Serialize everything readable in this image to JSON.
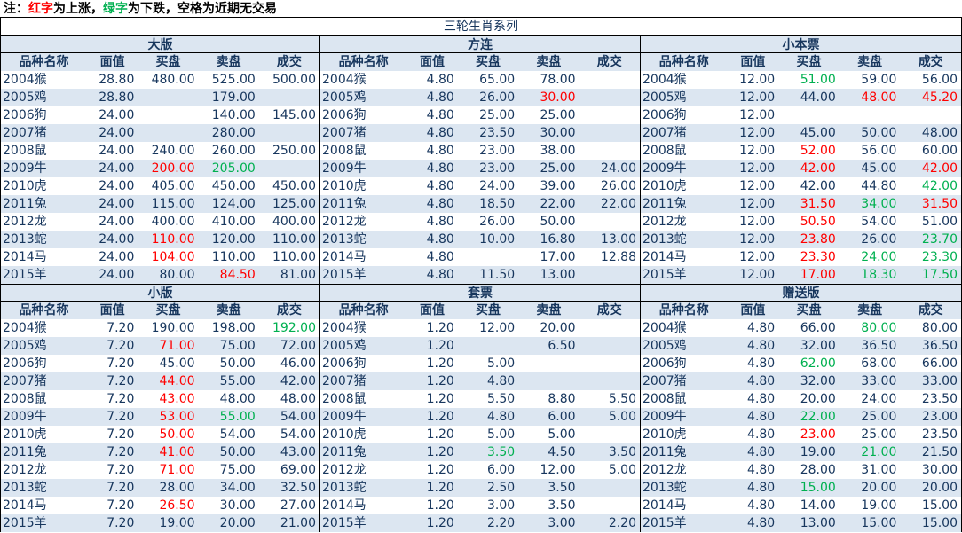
{
  "note": {
    "prefix": "注：",
    "red_word": "红字",
    "red_text": "为上涨，",
    "green_word": "绿字",
    "green_text": "为下跌，空格为近期无交易"
  },
  "title": "三轮生肖系列",
  "colors": {
    "up": "#ff0000",
    "down": "#00b050",
    "header_bg": "#dce6f1",
    "text": "#17365d"
  },
  "columns": [
    "品种名称",
    "面值",
    "买盘",
    "卖盘",
    "成交"
  ],
  "panels": [
    {
      "title": "大版",
      "rows": [
        {
          "name": "2004猴",
          "face": "28.80",
          "bid": "480.00",
          "ask": "525.00",
          "deal": "500.00"
        },
        {
          "name": "2005鸡",
          "face": "28.80",
          "bid": "",
          "ask": "179.00",
          "deal": ""
        },
        {
          "name": "2006狗",
          "face": "24.00",
          "bid": "",
          "ask": "140.00",
          "deal": "145.00"
        },
        {
          "name": "2007猪",
          "face": "24.00",
          "bid": "",
          "ask": "280.00",
          "deal": ""
        },
        {
          "name": "2008鼠",
          "face": "24.00",
          "bid": "240.00",
          "ask": "260.00",
          "deal": "250.00"
        },
        {
          "name": "2009牛",
          "face": "24.00",
          "bid": "200.00",
          "bid_c": "up",
          "ask": "205.00",
          "ask_c": "down",
          "deal": ""
        },
        {
          "name": "2010虎",
          "face": "24.00",
          "bid": "405.00",
          "ask": "450.00",
          "deal": "450.00"
        },
        {
          "name": "2011兔",
          "face": "24.00",
          "bid": "115.00",
          "ask": "124.00",
          "deal": "125.00"
        },
        {
          "name": "2012龙",
          "face": "24.00",
          "bid": "400.00",
          "ask": "410.00",
          "deal": "400.00"
        },
        {
          "name": "2013蛇",
          "face": "24.00",
          "bid": "110.00",
          "bid_c": "up",
          "ask": "120.00",
          "deal": "110.00"
        },
        {
          "name": "2014马",
          "face": "24.00",
          "bid": "104.00",
          "bid_c": "up",
          "ask": "110.00",
          "deal": "110.00"
        },
        {
          "name": "2015羊",
          "face": "24.00",
          "bid": "80.00",
          "ask": "84.50",
          "ask_c": "up",
          "deal": "81.00"
        }
      ]
    },
    {
      "title": "方连",
      "rows": [
        {
          "name": "2004猴",
          "face": "4.80",
          "bid": "65.00",
          "ask": "78.00",
          "deal": ""
        },
        {
          "name": "2005鸡",
          "face": "4.80",
          "bid": "26.00",
          "ask": "30.00",
          "ask_c": "up",
          "deal": ""
        },
        {
          "name": "2006狗",
          "face": "4.80",
          "bid": "25.00",
          "ask": "25.00",
          "deal": ""
        },
        {
          "name": "2007猪",
          "face": "4.80",
          "bid": "23.50",
          "ask": "30.00",
          "deal": ""
        },
        {
          "name": "2008鼠",
          "face": "4.80",
          "bid": "23.00",
          "ask": "38.00",
          "deal": ""
        },
        {
          "name": "2009牛",
          "face": "4.80",
          "bid": "23.00",
          "ask": "25.00",
          "deal": "24.00"
        },
        {
          "name": "2010虎",
          "face": "4.80",
          "bid": "24.00",
          "ask": "39.00",
          "deal": "26.00"
        },
        {
          "name": "2011兔",
          "face": "4.80",
          "bid": "18.50",
          "ask": "22.00",
          "deal": "22.00"
        },
        {
          "name": "2012龙",
          "face": "4.80",
          "bid": "26.00",
          "ask": "50.00",
          "deal": ""
        },
        {
          "name": "2013蛇",
          "face": "4.80",
          "bid": "10.00",
          "ask": "16.80",
          "deal": "13.00"
        },
        {
          "name": "2014马",
          "face": "4.80",
          "bid": "",
          "ask": "17.00",
          "deal": "12.88"
        },
        {
          "name": "2015羊",
          "face": "4.80",
          "bid": "11.50",
          "ask": "13.00",
          "deal": ""
        }
      ]
    },
    {
      "title": "小本票",
      "rows": [
        {
          "name": "2004猴",
          "face": "12.00",
          "bid": "51.00",
          "bid_c": "down",
          "ask": "59.00",
          "deal": "56.00"
        },
        {
          "name": "2005鸡",
          "face": "12.00",
          "bid": "44.00",
          "ask": "48.00",
          "ask_c": "up",
          "deal": "45.20",
          "deal_c": "up"
        },
        {
          "name": "2006狗",
          "face": "12.00",
          "bid": "",
          "ask": "",
          "deal": ""
        },
        {
          "name": "2007猪",
          "face": "12.00",
          "bid": "45.00",
          "ask": "50.00",
          "deal": "48.00"
        },
        {
          "name": "2008鼠",
          "face": "12.00",
          "bid": "52.00",
          "bid_c": "up",
          "ask": "56.00",
          "deal": "60.00"
        },
        {
          "name": "2009牛",
          "face": "12.00",
          "bid": "42.00",
          "bid_c": "up",
          "ask": "45.00",
          "deal": "42.00",
          "deal_c": "up"
        },
        {
          "name": "2010虎",
          "face": "12.00",
          "bid": "42.00",
          "ask": "44.80",
          "deal": "42.00",
          "deal_c": "down"
        },
        {
          "name": "2011兔",
          "face": "12.00",
          "bid": "31.50",
          "bid_c": "up",
          "ask": "34.00",
          "ask_c": "down",
          "deal": "31.50",
          "deal_c": "up"
        },
        {
          "name": "2012龙",
          "face": "12.00",
          "bid": "50.50",
          "bid_c": "up",
          "ask": "54.00",
          "deal": "51.00"
        },
        {
          "name": "2013蛇",
          "face": "12.00",
          "bid": "23.80",
          "bid_c": "up",
          "ask": "26.00",
          "deal": "23.70",
          "deal_c": "down"
        },
        {
          "name": "2014马",
          "face": "12.00",
          "bid": "23.30",
          "bid_c": "up",
          "ask": "24.00",
          "ask_c": "down",
          "deal": "23.30",
          "deal_c": "down"
        },
        {
          "name": "2015羊",
          "face": "12.00",
          "bid": "17.00",
          "bid_c": "up",
          "ask": "18.30",
          "ask_c": "down",
          "deal": "17.50",
          "deal_c": "down"
        }
      ]
    },
    {
      "title": "小版",
      "rows": [
        {
          "name": "2004猴",
          "face": "7.20",
          "bid": "190.00",
          "ask": "198.00",
          "deal": "192.00",
          "deal_c": "down"
        },
        {
          "name": "2005鸡",
          "face": "7.20",
          "bid": "71.00",
          "bid_c": "up",
          "ask": "75.00",
          "deal": "72.00"
        },
        {
          "name": "2006狗",
          "face": "7.20",
          "bid": "45.00",
          "ask": "50.00",
          "deal": "46.00"
        },
        {
          "name": "2007猪",
          "face": "7.20",
          "bid": "44.00",
          "bid_c": "up",
          "ask": "55.00",
          "deal": "42.00"
        },
        {
          "name": "2008鼠",
          "face": "7.20",
          "bid": "43.00",
          "bid_c": "up",
          "ask": "48.00",
          "deal": "48.00"
        },
        {
          "name": "2009牛",
          "face": "7.20",
          "bid": "53.00",
          "bid_c": "up",
          "ask": "55.00",
          "ask_c": "down",
          "deal": "54.00"
        },
        {
          "name": "2010虎",
          "face": "7.20",
          "bid": "50.00",
          "bid_c": "up",
          "ask": "54.00",
          "deal": "54.00"
        },
        {
          "name": "2011兔",
          "face": "7.20",
          "bid": "41.00",
          "bid_c": "up",
          "ask": "50.00",
          "deal": "43.00"
        },
        {
          "name": "2012龙",
          "face": "7.20",
          "bid": "71.00",
          "bid_c": "up",
          "ask": "75.00",
          "deal": "69.00"
        },
        {
          "name": "2013蛇",
          "face": "7.20",
          "bid": "28.00",
          "ask": "34.00",
          "deal": "32.50"
        },
        {
          "name": "2014马",
          "face": "7.20",
          "bid": "26.50",
          "bid_c": "up",
          "ask": "30.00",
          "deal": "27.00"
        },
        {
          "name": "2015羊",
          "face": "7.20",
          "bid": "19.00",
          "ask": "20.00",
          "deal": "21.00"
        }
      ]
    },
    {
      "title": "套票",
      "rows": [
        {
          "name": "2004猴",
          "face": "1.20",
          "bid": "12.00",
          "ask": "20.00",
          "deal": ""
        },
        {
          "name": "2005鸡",
          "face": "1.20",
          "bid": "",
          "ask": "6.50",
          "deal": ""
        },
        {
          "name": "2006狗",
          "face": "1.20",
          "bid": "5.00",
          "ask": "",
          "deal": ""
        },
        {
          "name": "2007猪",
          "face": "1.20",
          "bid": "4.80",
          "ask": "",
          "deal": ""
        },
        {
          "name": "2008鼠",
          "face": "1.20",
          "bid": "5.50",
          "ask": "8.80",
          "deal": "5.50"
        },
        {
          "name": "2009牛",
          "face": "1.20",
          "bid": "4.80",
          "ask": "6.00",
          "deal": "5.00"
        },
        {
          "name": "2010虎",
          "face": "1.20",
          "bid": "5.00",
          "ask": "5.00",
          "deal": ""
        },
        {
          "name": "2011兔",
          "face": "1.20",
          "bid": "3.50",
          "bid_c": "down",
          "ask": "4.50",
          "deal": "3.50"
        },
        {
          "name": "2012龙",
          "face": "1.20",
          "bid": "6.00",
          "ask": "12.00",
          "deal": "5.00"
        },
        {
          "name": "2013蛇",
          "face": "1.20",
          "bid": "2.50",
          "ask": "3.50",
          "deal": ""
        },
        {
          "name": "2014马",
          "face": "1.20",
          "bid": "3.00",
          "ask": "3.50",
          "deal": ""
        },
        {
          "name": "2015羊",
          "face": "1.20",
          "bid": "2.20",
          "ask": "3.00",
          "deal": "2.20"
        }
      ]
    },
    {
      "title": "赠送版",
      "rows": [
        {
          "name": "2004猴",
          "face": "4.80",
          "bid": "66.00",
          "ask": "80.00",
          "ask_c": "down",
          "deal": "80.00"
        },
        {
          "name": "2005鸡",
          "face": "4.80",
          "bid": "32.00",
          "ask": "36.50",
          "deal": "36.50"
        },
        {
          "name": "2006狗",
          "face": "4.80",
          "bid": "62.00",
          "bid_c": "down",
          "ask": "68.00",
          "deal": "66.00"
        },
        {
          "name": "2007猪",
          "face": "4.80",
          "bid": "32.00",
          "ask": "33.00",
          "deal": "33.00"
        },
        {
          "name": "2008鼠",
          "face": "4.80",
          "bid": "20.00",
          "ask": "24.00",
          "deal": "23.50"
        },
        {
          "name": "2009牛",
          "face": "4.80",
          "bid": "22.00",
          "bid_c": "down",
          "ask": "25.00",
          "deal": "23.00"
        },
        {
          "name": "2010虎",
          "face": "4.80",
          "bid": "23.00",
          "bid_c": "up",
          "ask": "25.00",
          "deal": "23.50"
        },
        {
          "name": "2011兔",
          "face": "4.80",
          "bid": "19.00",
          "ask": "21.00",
          "ask_c": "down",
          "deal": "21.50"
        },
        {
          "name": "2012龙",
          "face": "4.80",
          "bid": "28.00",
          "ask": "31.00",
          "deal": "30.00"
        },
        {
          "name": "2013蛇",
          "face": "4.80",
          "bid": "15.00",
          "bid_c": "down",
          "ask": "20.00",
          "deal": "20.00"
        },
        {
          "name": "2014马",
          "face": "4.80",
          "bid": "14.00",
          "ask": "19.00",
          "deal": "15.00"
        },
        {
          "name": "2015羊",
          "face": "4.80",
          "bid": "13.00",
          "ask": "15.00",
          "deal": "15.00"
        }
      ]
    }
  ]
}
